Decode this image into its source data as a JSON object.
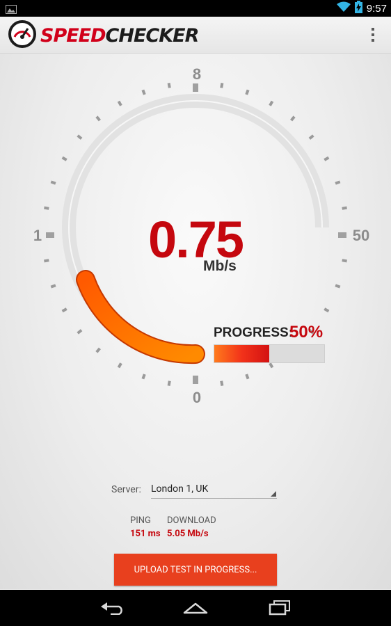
{
  "status_bar": {
    "time": "9:57",
    "icons": [
      "image-notification-icon",
      "wifi-icon",
      "battery-charging-icon"
    ]
  },
  "app_bar": {
    "logo_speed": "SPEED",
    "logo_checker": "CHECKER",
    "menu_icon": "overflow-menu-icon"
  },
  "gauge": {
    "scale_labels": {
      "top": "8",
      "left": "1",
      "right": "50",
      "bottom": "0"
    },
    "speed_value": "0.75",
    "speed_unit": "Mb/s",
    "needle_fraction": 0.25
  },
  "progress": {
    "label": "PROGRESS:",
    "percent_text": "50%",
    "value": 0.5
  },
  "server": {
    "label": "Server:",
    "selected": "London 1, UK"
  },
  "stats": {
    "ping_label": "PING",
    "ping_value": "151 ms",
    "download_label": "DOWNLOAD",
    "download_value": "5.05 Mb/s"
  },
  "action_button": {
    "label": "UPLOAD TEST IN PROGRESS..."
  },
  "colors": {
    "accent_red": "#c5070e",
    "gauge_orange": "#ff7300",
    "button": "#e8401e"
  },
  "nav_bar": {
    "icons": [
      "back-icon",
      "home-icon",
      "recents-icon"
    ]
  }
}
